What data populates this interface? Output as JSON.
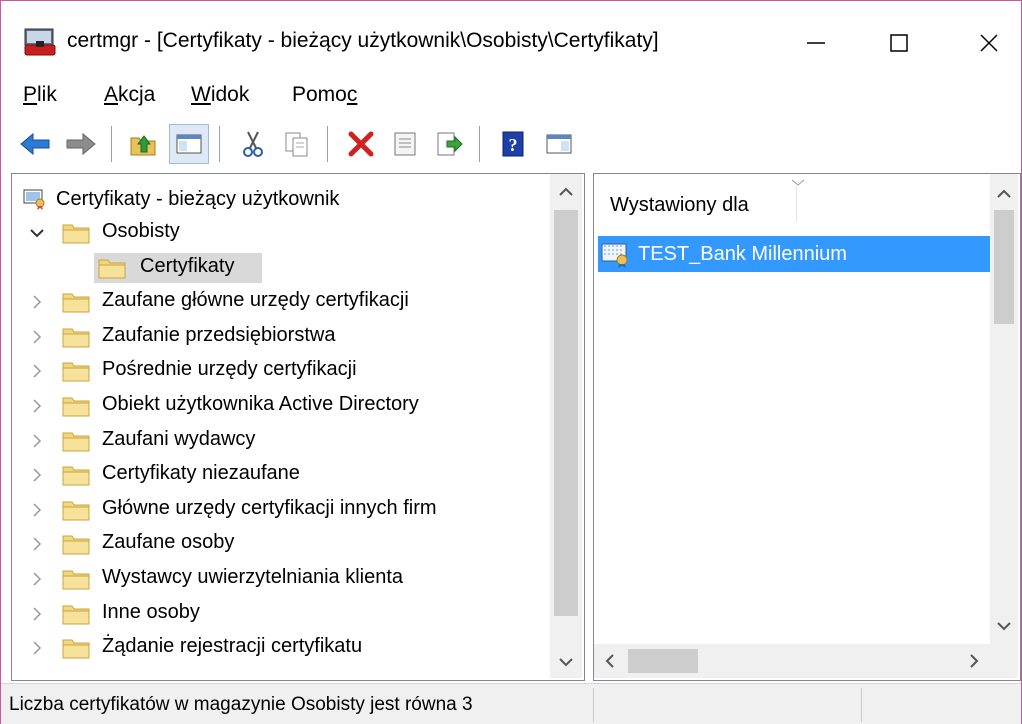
{
  "window": {
    "title": "certmgr - [Certyfikaty - bieżący użytkownik\\Osobisty\\Certyfikaty]",
    "minimize_glyph": "—",
    "maximize_glyph": "☐",
    "close_glyph": "✕"
  },
  "menu": {
    "items": [
      {
        "accel": "P",
        "rest": "lik"
      },
      {
        "accel": "A",
        "rest": "kcja"
      },
      {
        "accel": "W",
        "rest": "idok"
      },
      {
        "pre": "Pomo",
        "accel": "c"
      }
    ]
  },
  "toolbar": {
    "icons": [
      "back-arrow-icon",
      "forward-arrow-icon",
      "up-folder-icon",
      "show-hide-tree-icon",
      "cut-icon",
      "copy-icon",
      "delete-icon",
      "properties-icon",
      "export-list-icon",
      "help-icon",
      "action-pane-icon"
    ]
  },
  "tree": {
    "root": "Certyfikaty - bieżący użytkownik",
    "items": [
      {
        "label": "Osobisty",
        "expanded": true
      },
      {
        "label": "Certyfikaty",
        "selected": true
      },
      {
        "label": "Zaufane główne urzędy certyfikacji"
      },
      {
        "label": "Zaufanie przedsiębiorstwa"
      },
      {
        "label": "Pośrednie urzędy certyfikacji"
      },
      {
        "label": "Obiekt użytkownika Active Directory"
      },
      {
        "label": "Zaufani wydawcy"
      },
      {
        "label": "Certyfikaty niezaufane"
      },
      {
        "label": "Główne urzędy certyfikacji innych firm"
      },
      {
        "label": "Zaufane osoby"
      },
      {
        "label": "Wystawcy uwierzytelniania klienta"
      },
      {
        "label": "Inne osoby"
      },
      {
        "label": "Żądanie rejestracji certyfikatu"
      }
    ]
  },
  "list": {
    "column_header": "Wystawiony dla",
    "rows": [
      "TEST_Bank Millennium"
    ]
  },
  "status": {
    "text": "Liczba certyfikatów w magazynie Osobisty jest równa 3"
  },
  "colors": {
    "selection": "#3399ff",
    "tree_selection": "#d9d9d9",
    "folder": "#e8c15a"
  }
}
